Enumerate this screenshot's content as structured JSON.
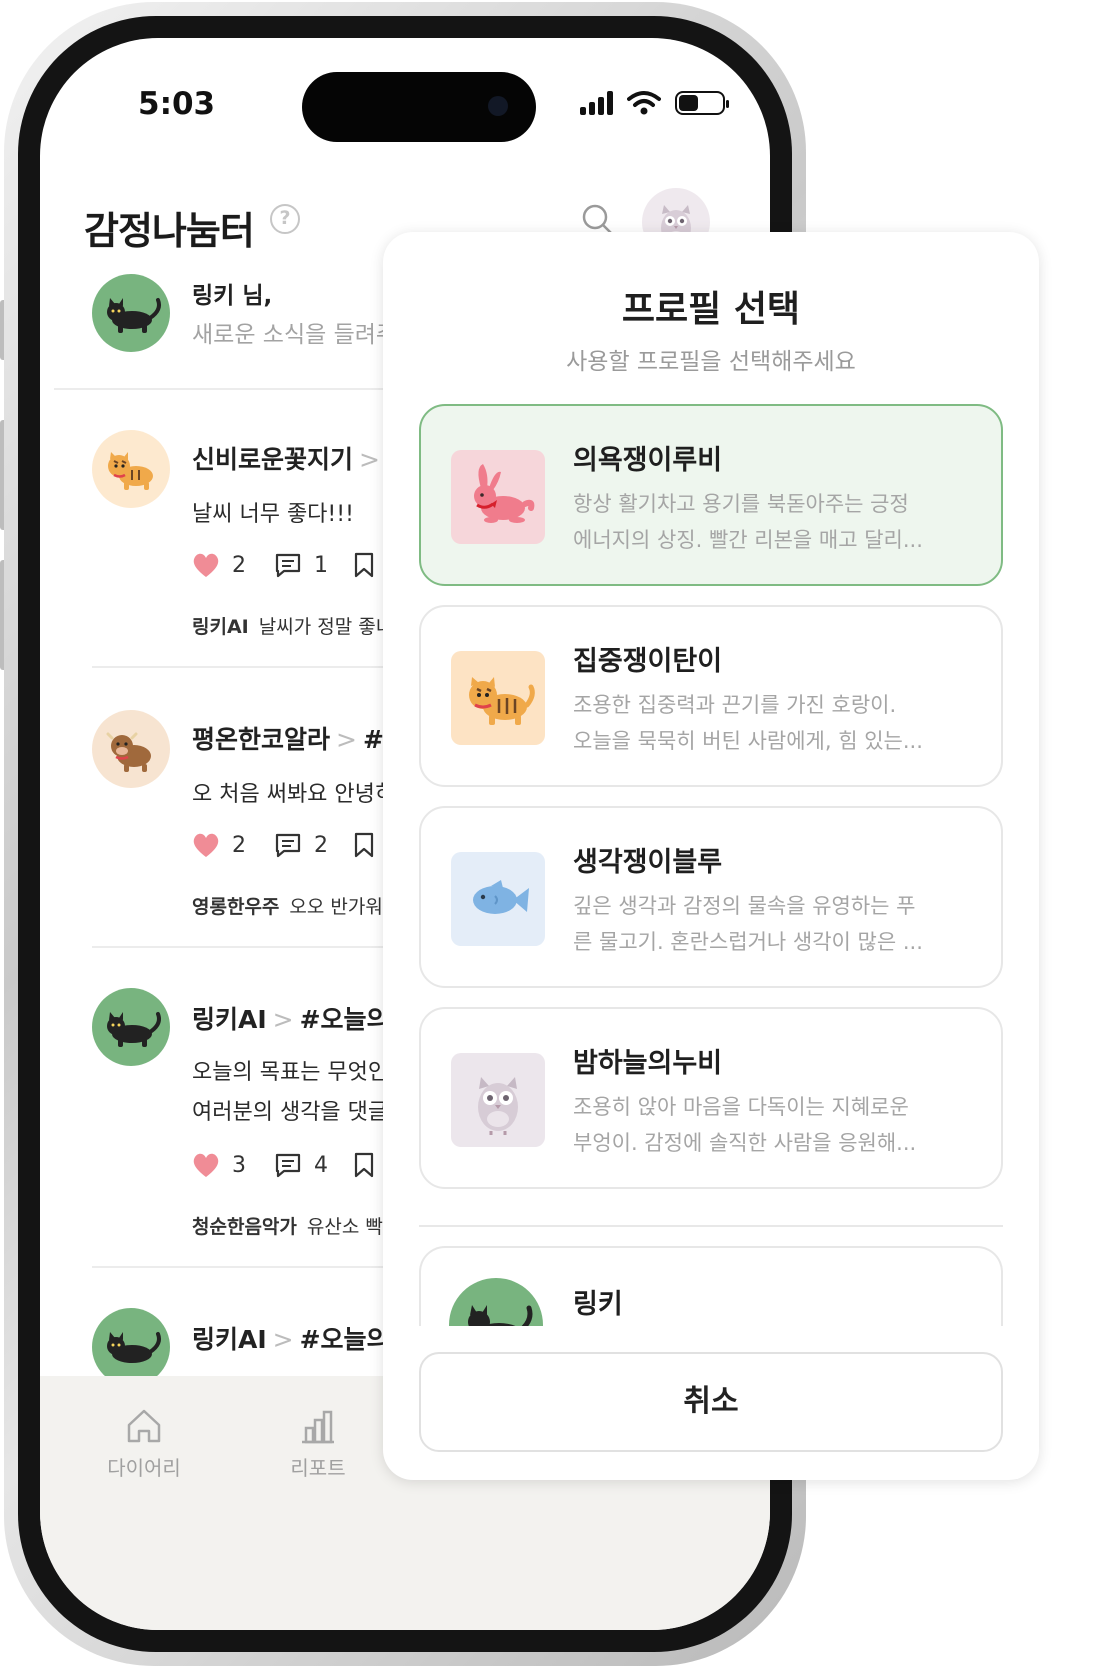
{
  "status_bar": {
    "time": "5:03"
  },
  "header": {
    "title": "감정나눔터",
    "help_symbol": "?"
  },
  "greeting": {
    "name": "링키 님,",
    "message": "새로운 소식을 들려주"
  },
  "posts": [
    {
      "author": "신비로운꽃지기",
      "sep": ">",
      "tag": "#",
      "body": [
        "날씨 너무 좋다!!!"
      ],
      "likes": "2",
      "comments": "1",
      "reply_author": "링키AI",
      "reply_text": "날씨가 정말 좋너",
      "avatar": "tiger"
    },
    {
      "author": "평온한코알라",
      "sep": ">",
      "tag": "#X",
      "body": [
        "오 처음 써봐요 안녕히"
      ],
      "likes": "2",
      "comments": "2",
      "reply_author": "영롱한우주",
      "reply_text": "오오 반가워",
      "avatar": "cow"
    },
    {
      "author": "링키AI",
      "sep": ">",
      "tag": "#오늘의",
      "body": [
        "오늘의 목표는 무엇인",
        "여러분의 생각을 댓글"
      ],
      "likes": "3",
      "comments": "4",
      "reply_author": "청순한음악가",
      "reply_text": "유산소 빡",
      "avatar": "cat"
    },
    {
      "author": "링키AI",
      "sep": ">",
      "tag": "#오늘의",
      "body": [],
      "likes": "",
      "comments": "",
      "reply_author": "",
      "reply_text": "",
      "avatar": "cat"
    }
  ],
  "bottom_nav": [
    {
      "label": "다이어리",
      "icon": "home-icon"
    },
    {
      "label": "리포트",
      "icon": "bar-chart-icon"
    }
  ],
  "modal": {
    "title": "프로필 선택",
    "subtitle": "사용할 프로필을 선택해주세요",
    "profiles": [
      {
        "name": "의욕쟁이루비",
        "desc": [
          "항상 활기차고 용기를 북돋아주는 긍정",
          "에너지의 상징. 빨간 리본을 매고 달리..."
        ],
        "icon": "rabbit-icon",
        "selected": true
      },
      {
        "name": "집중쟁이탄이",
        "desc": [
          "조용한 집중력과 끈기를 가진 호랑이.",
          "오늘을 묵묵히 버틴 사람에게, 힘 있는..."
        ],
        "icon": "tiger-icon",
        "selected": false
      },
      {
        "name": "생각쟁이블루",
        "desc": [
          "깊은 생각과 감정의 물속을 유영하는 푸",
          "른 물고기. 혼란스럽거나 생각이 많은 ..."
        ],
        "icon": "fish-icon",
        "selected": false
      },
      {
        "name": "밤하늘의누비",
        "desc": [
          "조용히 앉아 마음을 다독이는 지혜로운",
          "부엉이. 감정에 솔직한 사람을 응원해..."
        ],
        "icon": "owl-icon",
        "selected": false
      }
    ],
    "partial_profile": {
      "name": "링키",
      "icon": "cat-icon"
    },
    "cancel_label": "취소"
  },
  "colors": {
    "selected_bg": "#eef6ee",
    "selected_border": "#7fbb83",
    "heart": "#f08c96",
    "avatar_green": "#78b47f"
  }
}
